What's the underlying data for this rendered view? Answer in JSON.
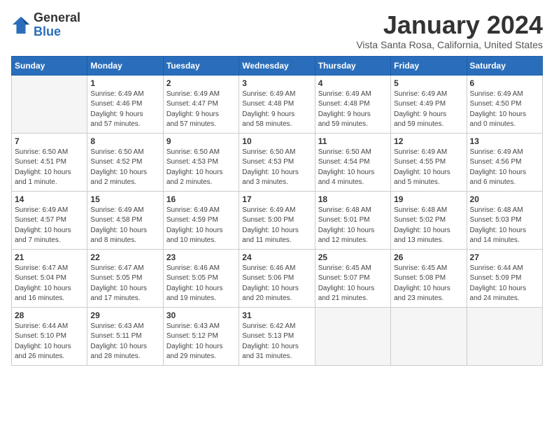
{
  "logo": {
    "general": "General",
    "blue": "Blue"
  },
  "title": "January 2024",
  "subtitle": "Vista Santa Rosa, California, United States",
  "days_of_week": [
    "Sunday",
    "Monday",
    "Tuesday",
    "Wednesday",
    "Thursday",
    "Friday",
    "Saturday"
  ],
  "weeks": [
    [
      {
        "day": "",
        "info": ""
      },
      {
        "day": "1",
        "info": "Sunrise: 6:49 AM\nSunset: 4:46 PM\nDaylight: 9 hours\nand 57 minutes."
      },
      {
        "day": "2",
        "info": "Sunrise: 6:49 AM\nSunset: 4:47 PM\nDaylight: 9 hours\nand 57 minutes."
      },
      {
        "day": "3",
        "info": "Sunrise: 6:49 AM\nSunset: 4:48 PM\nDaylight: 9 hours\nand 58 minutes."
      },
      {
        "day": "4",
        "info": "Sunrise: 6:49 AM\nSunset: 4:48 PM\nDaylight: 9 hours\nand 59 minutes."
      },
      {
        "day": "5",
        "info": "Sunrise: 6:49 AM\nSunset: 4:49 PM\nDaylight: 9 hours\nand 59 minutes."
      },
      {
        "day": "6",
        "info": "Sunrise: 6:49 AM\nSunset: 4:50 PM\nDaylight: 10 hours\nand 0 minutes."
      }
    ],
    [
      {
        "day": "7",
        "info": "Sunrise: 6:50 AM\nSunset: 4:51 PM\nDaylight: 10 hours\nand 1 minute."
      },
      {
        "day": "8",
        "info": "Sunrise: 6:50 AM\nSunset: 4:52 PM\nDaylight: 10 hours\nand 2 minutes."
      },
      {
        "day": "9",
        "info": "Sunrise: 6:50 AM\nSunset: 4:53 PM\nDaylight: 10 hours\nand 2 minutes."
      },
      {
        "day": "10",
        "info": "Sunrise: 6:50 AM\nSunset: 4:53 PM\nDaylight: 10 hours\nand 3 minutes."
      },
      {
        "day": "11",
        "info": "Sunrise: 6:50 AM\nSunset: 4:54 PM\nDaylight: 10 hours\nand 4 minutes."
      },
      {
        "day": "12",
        "info": "Sunrise: 6:49 AM\nSunset: 4:55 PM\nDaylight: 10 hours\nand 5 minutes."
      },
      {
        "day": "13",
        "info": "Sunrise: 6:49 AM\nSunset: 4:56 PM\nDaylight: 10 hours\nand 6 minutes."
      }
    ],
    [
      {
        "day": "14",
        "info": "Sunrise: 6:49 AM\nSunset: 4:57 PM\nDaylight: 10 hours\nand 7 minutes."
      },
      {
        "day": "15",
        "info": "Sunrise: 6:49 AM\nSunset: 4:58 PM\nDaylight: 10 hours\nand 8 minutes."
      },
      {
        "day": "16",
        "info": "Sunrise: 6:49 AM\nSunset: 4:59 PM\nDaylight: 10 hours\nand 10 minutes."
      },
      {
        "day": "17",
        "info": "Sunrise: 6:49 AM\nSunset: 5:00 PM\nDaylight: 10 hours\nand 11 minutes."
      },
      {
        "day": "18",
        "info": "Sunrise: 6:48 AM\nSunset: 5:01 PM\nDaylight: 10 hours\nand 12 minutes."
      },
      {
        "day": "19",
        "info": "Sunrise: 6:48 AM\nSunset: 5:02 PM\nDaylight: 10 hours\nand 13 minutes."
      },
      {
        "day": "20",
        "info": "Sunrise: 6:48 AM\nSunset: 5:03 PM\nDaylight: 10 hours\nand 14 minutes."
      }
    ],
    [
      {
        "day": "21",
        "info": "Sunrise: 6:47 AM\nSunset: 5:04 PM\nDaylight: 10 hours\nand 16 minutes."
      },
      {
        "day": "22",
        "info": "Sunrise: 6:47 AM\nSunset: 5:05 PM\nDaylight: 10 hours\nand 17 minutes."
      },
      {
        "day": "23",
        "info": "Sunrise: 6:46 AM\nSunset: 5:05 PM\nDaylight: 10 hours\nand 19 minutes."
      },
      {
        "day": "24",
        "info": "Sunrise: 6:46 AM\nSunset: 5:06 PM\nDaylight: 10 hours\nand 20 minutes."
      },
      {
        "day": "25",
        "info": "Sunrise: 6:45 AM\nSunset: 5:07 PM\nDaylight: 10 hours\nand 21 minutes."
      },
      {
        "day": "26",
        "info": "Sunrise: 6:45 AM\nSunset: 5:08 PM\nDaylight: 10 hours\nand 23 minutes."
      },
      {
        "day": "27",
        "info": "Sunrise: 6:44 AM\nSunset: 5:09 PM\nDaylight: 10 hours\nand 24 minutes."
      }
    ],
    [
      {
        "day": "28",
        "info": "Sunrise: 6:44 AM\nSunset: 5:10 PM\nDaylight: 10 hours\nand 26 minutes."
      },
      {
        "day": "29",
        "info": "Sunrise: 6:43 AM\nSunset: 5:11 PM\nDaylight: 10 hours\nand 28 minutes."
      },
      {
        "day": "30",
        "info": "Sunrise: 6:43 AM\nSunset: 5:12 PM\nDaylight: 10 hours\nand 29 minutes."
      },
      {
        "day": "31",
        "info": "Sunrise: 6:42 AM\nSunset: 5:13 PM\nDaylight: 10 hours\nand 31 minutes."
      },
      {
        "day": "",
        "info": ""
      },
      {
        "day": "",
        "info": ""
      },
      {
        "day": "",
        "info": ""
      }
    ]
  ]
}
